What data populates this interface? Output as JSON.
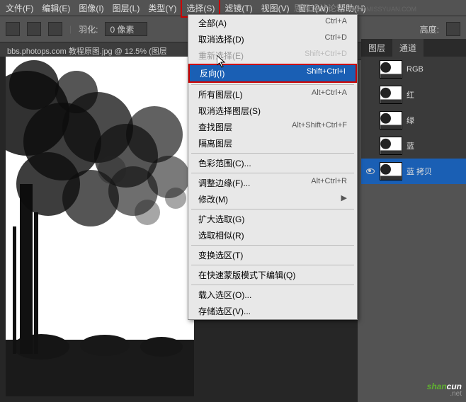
{
  "menubar": {
    "items": [
      {
        "label": "文件(F)"
      },
      {
        "label": "编辑(E)"
      },
      {
        "label": "图像(I)"
      },
      {
        "label": "图层(L)"
      },
      {
        "label": "类型(Y)"
      },
      {
        "label": "选择(S)",
        "highlight": true
      },
      {
        "label": "滤镜(T)"
      },
      {
        "label": "视图(V)"
      },
      {
        "label": "窗口(W)"
      },
      {
        "label": "帮助(H)"
      }
    ]
  },
  "header_brand": "思缘设计论坛",
  "header_url": "WWW.MISSYUAN.COM",
  "toolbar": {
    "feather_label": "羽化:",
    "feather_value": "0 像素",
    "height_label": "高度:"
  },
  "doctab": "bbs.photops.com 教程原图.jpg @ 12.5% (图层",
  "dropdown": {
    "items": [
      {
        "label": "全部(A)",
        "shortcut": "Ctrl+A"
      },
      {
        "label": "取消选择(D)",
        "shortcut": "Ctrl+D"
      },
      {
        "label": "重新选择(E)",
        "shortcut": "Shift+Ctrl+D",
        "disabled": true
      },
      {
        "label": "反向(I)",
        "shortcut": "Shift+Ctrl+I",
        "selected": true
      },
      {
        "sep": true
      },
      {
        "label": "所有图层(L)",
        "shortcut": "Alt+Ctrl+A"
      },
      {
        "label": "取消选择图层(S)"
      },
      {
        "label": "查找图层",
        "shortcut": "Alt+Shift+Ctrl+F"
      },
      {
        "label": "隔离图层"
      },
      {
        "sep": true
      },
      {
        "label": "色彩范围(C)..."
      },
      {
        "sep": true
      },
      {
        "label": "调整边缘(F)...",
        "shortcut": "Alt+Ctrl+R"
      },
      {
        "label": "修改(M)",
        "arrow": true
      },
      {
        "sep": true
      },
      {
        "label": "扩大选取(G)"
      },
      {
        "label": "选取相似(R)"
      },
      {
        "sep": true
      },
      {
        "label": "变换选区(T)"
      },
      {
        "sep": true
      },
      {
        "label": "在快速蒙版模式下编辑(Q)"
      },
      {
        "sep": true
      },
      {
        "label": "载入选区(O)..."
      },
      {
        "label": "存储选区(V)..."
      }
    ]
  },
  "panels": {
    "tabs": [
      {
        "label": "图层"
      },
      {
        "label": "通道",
        "active": true
      }
    ],
    "channels": [
      {
        "name": "RGB",
        "eye": false
      },
      {
        "name": "红",
        "eye": false
      },
      {
        "name": "绿",
        "eye": false
      },
      {
        "name": "蓝",
        "eye": false
      },
      {
        "name": "蓝 拷贝",
        "eye": true,
        "active": true
      }
    ]
  },
  "watermark": {
    "s": "shan",
    "c": "cun",
    "net": ".net"
  }
}
